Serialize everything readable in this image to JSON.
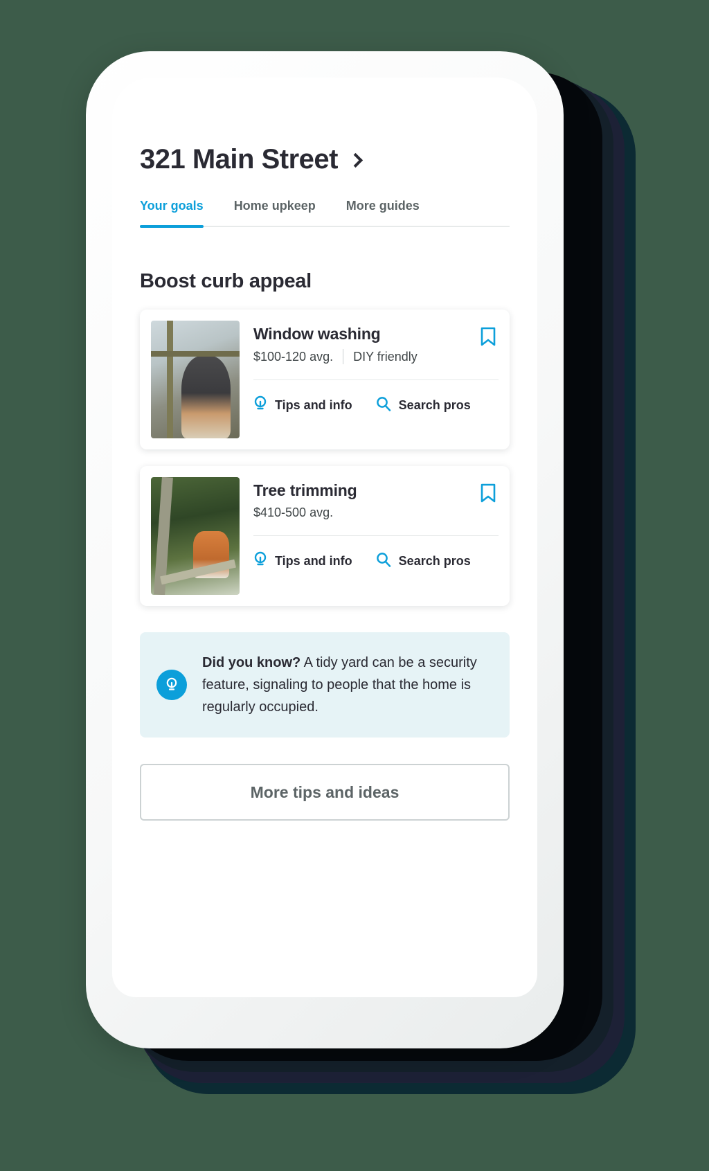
{
  "theme": {
    "background": "#3d5c4a",
    "accent": "#0c9fda",
    "text_dark": "#2a2a33",
    "text_muted": "#5c6466",
    "callout_bg": "#e6f3f6"
  },
  "header": {
    "address": "321 Main Street",
    "chevron_icon": "chevron-right-icon"
  },
  "tabs": [
    {
      "label": "Your goals",
      "active": true
    },
    {
      "label": "Home upkeep",
      "active": false
    },
    {
      "label": "More guides",
      "active": false
    }
  ],
  "section": {
    "title": "Boost curb appeal"
  },
  "cards": [
    {
      "title": "Window washing",
      "price": "$100-120 avg.",
      "tag": "DIY friendly",
      "bookmark_icon": "bookmark-icon",
      "thumbnail_alt": "person washing a window",
      "actions": [
        {
          "label": "Tips and info",
          "icon": "lightbulb-icon"
        },
        {
          "label": "Search pros",
          "icon": "search-icon"
        }
      ]
    },
    {
      "title": "Tree trimming",
      "price": "$410-500 avg.",
      "tag": "",
      "bookmark_icon": "bookmark-icon",
      "thumbnail_alt": "person trimming a tree branch",
      "actions": [
        {
          "label": "Tips and info",
          "icon": "lightbulb-icon"
        },
        {
          "label": "Search pros",
          "icon": "search-icon"
        }
      ]
    }
  ],
  "callout": {
    "icon": "lightbulb-circle-icon",
    "lead": "Did you know?",
    "body": " A tidy yard can be a security feature, signaling to people that the home is regularly occupied."
  },
  "footer": {
    "more_button": "More tips and ideas"
  }
}
